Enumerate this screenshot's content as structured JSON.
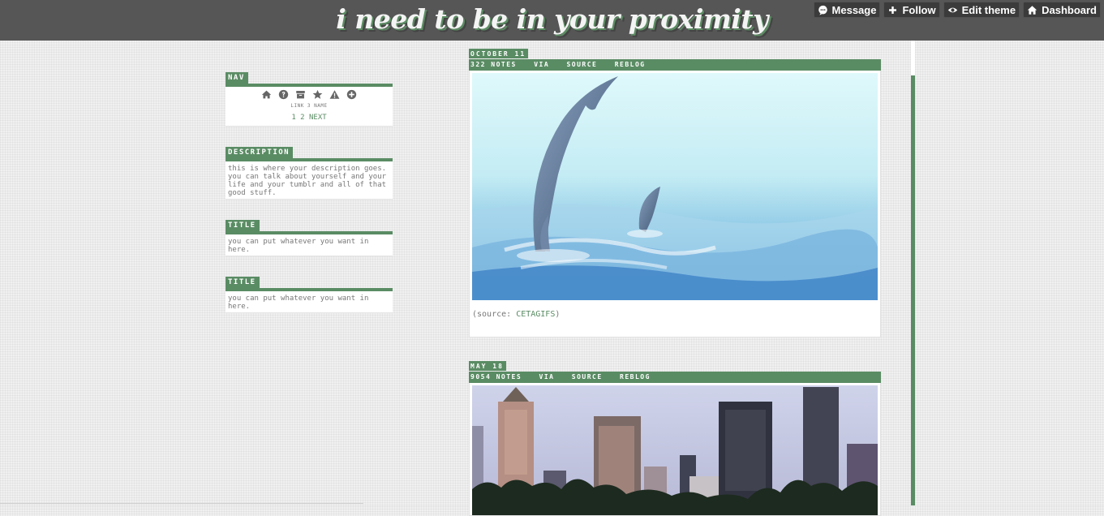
{
  "header": {
    "title": "i need to be in your proximity",
    "buttons": [
      {
        "label": "Message",
        "icon": "message-bubble-icon"
      },
      {
        "label": "Follow",
        "icon": "plus-icon"
      },
      {
        "label": "Edit theme",
        "icon": "eye-icon"
      },
      {
        "label": "Dashboard",
        "icon": "home-icon"
      }
    ]
  },
  "sidebar": {
    "nav": {
      "heading": "NAV",
      "icons": [
        "home-icon",
        "question-icon",
        "archive-icon",
        "star-icon",
        "warning-icon",
        "plus-circle-icon"
      ],
      "link_name": "LINK 3 NAME",
      "pager": [
        "1",
        "2",
        "NEXT"
      ]
    },
    "description": {
      "heading": "DESCRIPTION",
      "text": "this is where your description goes. you can talk about yourself and your life and your tumblr and all of that good stuff."
    },
    "widgets": [
      {
        "heading": "TITLE",
        "text": "you can put whatever you want in here."
      },
      {
        "heading": "TITLE",
        "text": "you can put whatever you want in here."
      }
    ]
  },
  "posts": [
    {
      "date": "OCTOBER 11",
      "notes": "322 NOTES",
      "actions": [
        "VIA",
        "SOURCE",
        "REBLOG"
      ],
      "image": "dolphins-jumping-photo",
      "caption_prefix": "(source: ",
      "caption_link": "CETAGIFS",
      "caption_suffix": ")"
    },
    {
      "date": "MAY 18",
      "notes": "9054 NOTES",
      "actions": [
        "VIA",
        "SOURCE",
        "REBLOG"
      ],
      "image": "city-skyline-photo"
    }
  ],
  "colors": {
    "accent": "#5a8c64",
    "topbar": "#565656",
    "text": "#777777"
  }
}
